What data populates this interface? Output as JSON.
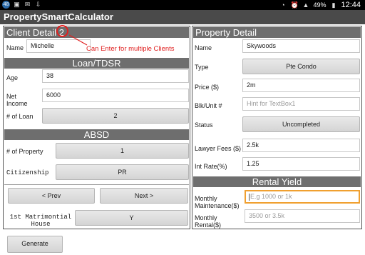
{
  "status_bar": {
    "left_icons": [
      "notification-badge-icon",
      "image-icon",
      "mail-icon",
      "download-icon"
    ],
    "badge": "48",
    "battery": "49%",
    "time": "12:44"
  },
  "app": {
    "title": "PropertySmartCalculator"
  },
  "client": {
    "header": "Client Detail 2",
    "name_label": "Name",
    "name_value": "Michelle",
    "annotation": "Can Enter for multiple Clients"
  },
  "loan": {
    "header": "Loan/TDSR",
    "age_label": "Age",
    "age_value": "38",
    "income_label": "Net\nIncome",
    "income_value": "6000",
    "num_loan_label": "# of Loan",
    "num_loan_value": "2"
  },
  "absd": {
    "header": "ABSD",
    "num_property_label": "# of Property",
    "num_property_value": "1",
    "citizenship_label": "Citizenship",
    "citizenship_value": "PR"
  },
  "nav": {
    "prev": "< Prev",
    "next": "Next >"
  },
  "matrimonial": {
    "label": "1st Matrimontial\nHouse",
    "value": "Y"
  },
  "property": {
    "header": "Property Detail",
    "name_label": "Name",
    "name_value": "Skywoods",
    "type_label": "Type",
    "type_value": "Pte Condo",
    "price_label": "Price ($)",
    "price_value": "2m",
    "blk_label": "Blk/Unit #",
    "blk_hint": "Hint for TextBox1",
    "status_label": "Status",
    "status_value": "Uncompleted",
    "lawyer_label": "Lawyer Fees ($)",
    "lawyer_value": "2.5k",
    "rate_label": "Int Rate(%)",
    "rate_value": "1.25"
  },
  "rental": {
    "header": "Rental Yield",
    "maintenance_label": "Monthly\nMaintenance($)",
    "maintenance_hint": "E.g 1000 or 1k",
    "rental_label": "Monthly\nRental($)",
    "rental_hint": "3500 or 3.5k"
  },
  "generate": "Generate"
}
